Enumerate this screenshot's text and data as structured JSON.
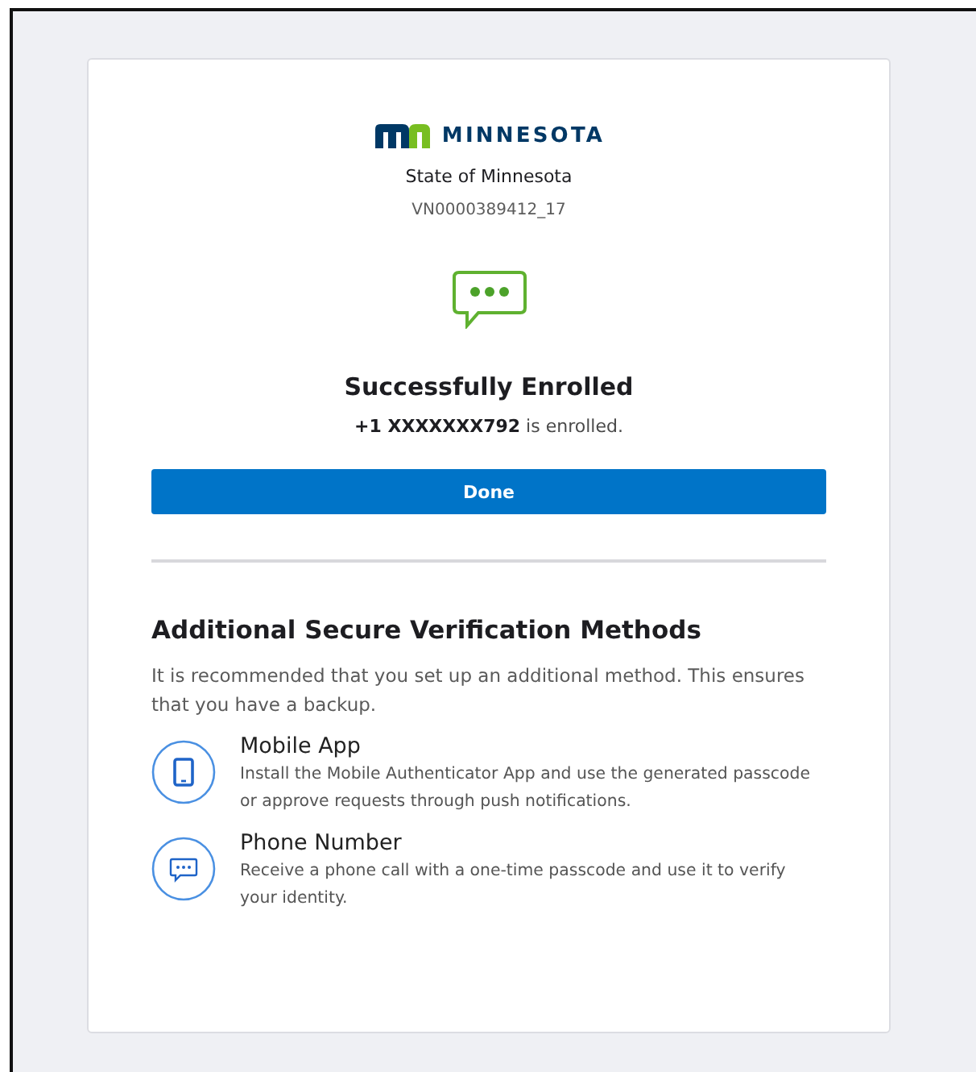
{
  "brand": {
    "wordmark": "MINNESOTA",
    "org": "State of Minnesota",
    "code": "VN0000389412_17"
  },
  "result": {
    "title": "Successfully Enrolled",
    "detail": "**+1 XXXXXXX792** is enrolled.",
    "button": "Done"
  },
  "additional": {
    "title": "Additional Secure Verification Methods",
    "description": "It is recommended that you set up an additional method. This ensures that you have a backup.",
    "methods": [
      {
        "kind": "mobile",
        "title": "Mobile App",
        "description": "Install the Mobile Authenticator App and use the generated passcode or approve requests through push notifications."
      },
      {
        "kind": "phone",
        "title": "Phone Number",
        "description": "Receive a phone call with a one-time passcode and use it to verify your identity."
      }
    ]
  }
}
